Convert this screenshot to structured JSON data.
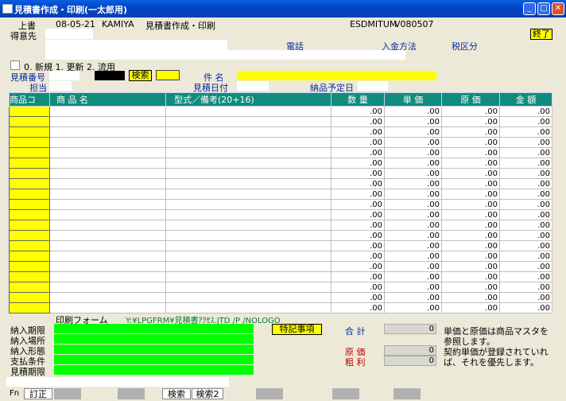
{
  "window": {
    "title": "見積書作成・印刷(一太郎用)"
  },
  "header": {
    "kind": "上書",
    "date": "08-05-21",
    "user": "KAMIYA",
    "screen_title": "見積書作成・印刷",
    "program_id": "ESDMITUM",
    "version": "V080507",
    "exit_label": "終了"
  },
  "customer": {
    "label": "得意先",
    "phone_label": "電話",
    "payment_label": "入金方法",
    "tax_label": "税区分"
  },
  "mode_options": "0. 新規  1. 更新  2. 流用",
  "estimate": {
    "number_label": "見積番号",
    "search_label": "検索",
    "subject_label": "件  名",
    "staff_label": "担当",
    "estimate_date_label": "見積日付",
    "delivery_date_label": "納品予定日"
  },
  "table": {
    "headers": [
      "商品コ",
      "商  品   名",
      "型式／備考(20+16)",
      "数  量",
      "単  価",
      "原  価",
      "金  額"
    ],
    "rows": [
      {
        "qty": ".00",
        "price": ".00",
        "cost": ".00",
        "amount": ".00"
      },
      {
        "qty": ".00",
        "price": ".00",
        "cost": ".00",
        "amount": ".00"
      },
      {
        "qty": ".00",
        "price": ".00",
        "cost": ".00",
        "amount": ".00"
      },
      {
        "qty": ".00",
        "price": ".00",
        "cost": ".00",
        "amount": ".00"
      },
      {
        "qty": ".00",
        "price": ".00",
        "cost": ".00",
        "amount": ".00"
      },
      {
        "qty": ".00",
        "price": ".00",
        "cost": ".00",
        "amount": ".00"
      },
      {
        "qty": ".00",
        "price": ".00",
        "cost": ".00",
        "amount": ".00"
      },
      {
        "qty": ".00",
        "price": ".00",
        "cost": ".00",
        "amount": ".00"
      },
      {
        "qty": ".00",
        "price": ".00",
        "cost": ".00",
        "amount": ".00"
      },
      {
        "qty": ".00",
        "price": ".00",
        "cost": ".00",
        "amount": ".00"
      },
      {
        "qty": ".00",
        "price": ".00",
        "cost": ".00",
        "amount": ".00"
      },
      {
        "qty": ".00",
        "price": ".00",
        "cost": ".00",
        "amount": ".00"
      },
      {
        "qty": ".00",
        "price": ".00",
        "cost": ".00",
        "amount": ".00"
      },
      {
        "qty": ".00",
        "price": ".00",
        "cost": ".00",
        "amount": ".00"
      },
      {
        "qty": ".00",
        "price": ".00",
        "cost": ".00",
        "amount": ".00"
      },
      {
        "qty": ".00",
        "price": ".00",
        "cost": ".00",
        "amount": ".00"
      },
      {
        "qty": ".00",
        "price": ".00",
        "cost": ".00",
        "amount": ".00"
      },
      {
        "qty": ".00",
        "price": ".00",
        "cost": ".00",
        "amount": ".00"
      },
      {
        "qty": ".00",
        "price": ".00",
        "cost": ".00",
        "amount": ".00"
      },
      {
        "qty": ".00",
        "price": ".00",
        "cost": ".00",
        "amount": ".00"
      }
    ]
  },
  "print_form": {
    "label": "印刷フォーム",
    "path": "Y:¥LPGFRM¥見積書ｱｸｾｽ.JTD /P /NOLOGO"
  },
  "conditions": [
    "納入期限",
    "納入場所",
    "納入形態",
    "支払条件",
    "見積期限"
  ],
  "special_button": "特記事項",
  "totals": {
    "total_label": "合 計",
    "total_value": "0",
    "cost_label": "原  価",
    "cost_value": "0",
    "profit_label": "粗  利",
    "profit_value": "0"
  },
  "note": [
    "単価と原価は商品マスタを",
    "参照します。",
    "契約単価が登録されていれ",
    "ば、それを優先します。"
  ],
  "fkeys": {
    "fn": "Fn",
    "correct": "訂正",
    "search": "検索",
    "search2": "検索2"
  },
  "colors": {
    "grid_header": "#0f8c7c",
    "input_yellow": "#ffff00",
    "input_green": "#00ff00",
    "titlebar": "#0046c8"
  }
}
